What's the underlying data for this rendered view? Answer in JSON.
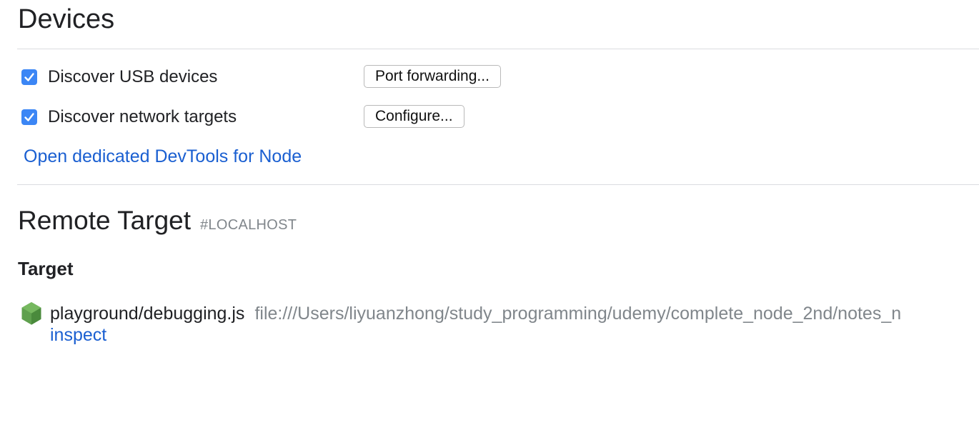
{
  "devices": {
    "title": "Devices",
    "options": [
      {
        "label": "Discover USB devices",
        "checked": true,
        "button": "Port forwarding..."
      },
      {
        "label": "Discover network targets",
        "checked": true,
        "button": "Configure..."
      }
    ],
    "node_link": "Open dedicated DevTools for Node"
  },
  "remote": {
    "title": "Remote Target",
    "tag": "#LOCALHOST",
    "section_title": "Target",
    "targets": [
      {
        "name": "playground/debugging.js",
        "url": "file:///Users/liyuanzhong/study_programming/udemy/complete_node_2nd/notes_n",
        "action": "inspect",
        "icon": "node-icon"
      }
    ]
  },
  "colors": {
    "checkbox": "#3b86f5",
    "link": "#1a5fd1",
    "muted": "#80868b",
    "node_green": "#5fa04e"
  }
}
